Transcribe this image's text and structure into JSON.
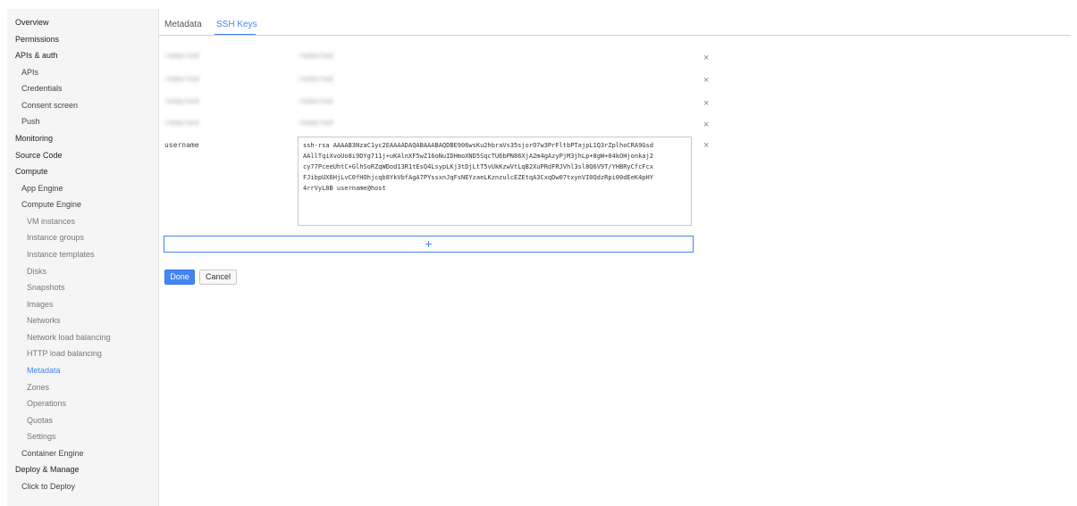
{
  "sidebar": {
    "items": [
      {
        "label": "Overview",
        "level": 0
      },
      {
        "label": "Permissions",
        "level": 0
      },
      {
        "label": "APIs & auth",
        "level": 0
      },
      {
        "label": "APIs",
        "level": 1
      },
      {
        "label": "Credentials",
        "level": 1
      },
      {
        "label": "Consent screen",
        "level": 1
      },
      {
        "label": "Push",
        "level": 1
      },
      {
        "label": "Monitoring",
        "level": 0
      },
      {
        "label": "Source Code",
        "level": 0
      },
      {
        "label": "Compute",
        "level": 0
      },
      {
        "label": "App Engine",
        "level": 1
      },
      {
        "label": "Compute Engine",
        "level": 1
      },
      {
        "label": "VM instances",
        "level": 2
      },
      {
        "label": "Instance groups",
        "level": 2
      },
      {
        "label": "Instance templates",
        "level": 2
      },
      {
        "label": "Disks",
        "level": 2
      },
      {
        "label": "Snapshots",
        "level": 2
      },
      {
        "label": "Images",
        "level": 2
      },
      {
        "label": "Networks",
        "level": 2
      },
      {
        "label": "Network load balancing",
        "level": 2
      },
      {
        "label": "HTTP load balancing",
        "level": 2
      },
      {
        "label": "Metadata",
        "level": 2,
        "active": true
      },
      {
        "label": "Zones",
        "level": 2
      },
      {
        "label": "Operations",
        "level": 2
      },
      {
        "label": "Quotas",
        "level": 2
      },
      {
        "label": "Settings",
        "level": 2
      },
      {
        "label": "Container Engine",
        "level": 1
      },
      {
        "label": "Deploy & Manage",
        "level": 0
      },
      {
        "label": "Click to Deploy",
        "level": 1
      }
    ]
  },
  "tabs": {
    "metadata": "Metadata",
    "ssh_keys": "SSH Keys"
  },
  "keys": {
    "rows": [
      {
        "user": "redacted",
        "key": "redacted",
        "remove": "×"
      },
      {
        "user": "redacted",
        "key": "redacted",
        "remove": "×"
      },
      {
        "user": "redacted",
        "key": "redacted",
        "remove": "×"
      },
      {
        "user": "redacted",
        "key": "redacted",
        "remove": "×"
      }
    ],
    "editing": {
      "user": "username",
      "key_lines": [
        "ssh-rsa AAAAB3NzaC1yc2EAAAADAQABAAABAQDBE906wsKu2hbraVs35sjorO7w3PrFltbPTajpL1Q3rZplhoCRA9Gsd",
        "AAllTqiXvoUo8i9DYg711j+uKAlnXF5wZ16oNuIDHmoXND5SqcTU6bPN86XjA2m4gAzyPjM3jhLp+8gW+04kOHjonkaj2",
        "cy77PceeUhtC+GlhSoRZqWDod13R1tEsQ4LsypLKj3tDjLtT5vUkKzwVtLqB2XuPRdFRJVhl3sl8Q6V9T/YHBRyCfcFcx",
        "FJibpUX6HjLvC0fHOhjcqb8YkVbfAgA7PYssxnJqFsNEYzaeLKznzulcEZEtqA3CxqDw07txynVI0QdzRpi00dEeK4pHY",
        "4rrVyL8B username@host"
      ],
      "remove": "×"
    }
  },
  "actions": {
    "add": "+",
    "done": "Done",
    "cancel": "Cancel"
  }
}
